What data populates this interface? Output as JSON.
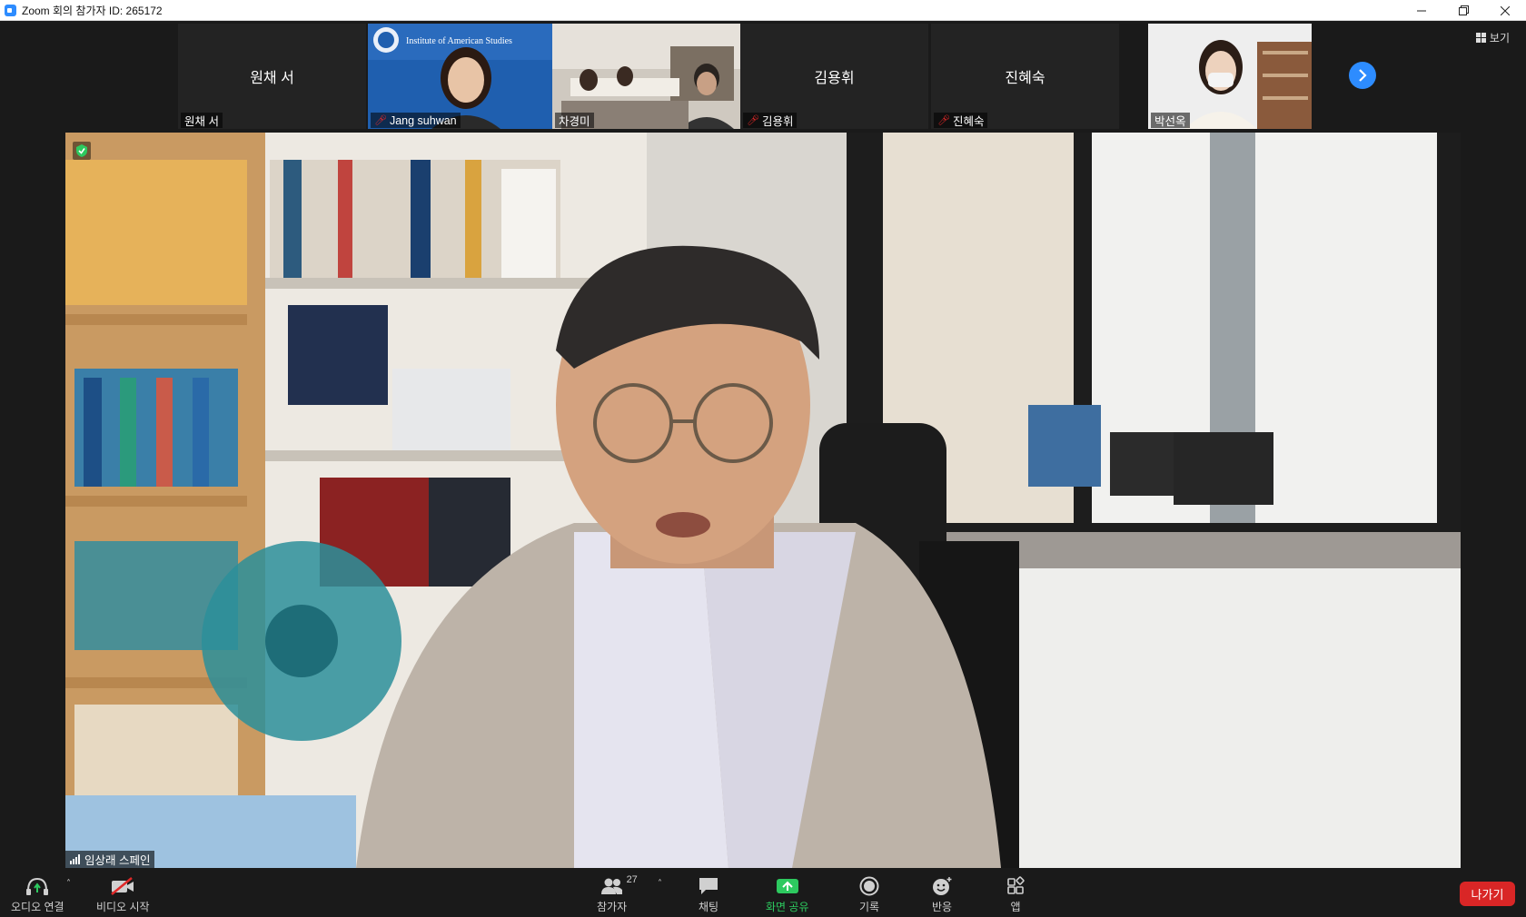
{
  "window": {
    "title": "Zoom 회의 참가자 ID: 265172"
  },
  "gallery": {
    "view_label": "보기",
    "participants": [
      {
        "display": "원채 서",
        "label": "원채 서",
        "muted": false,
        "video": false
      },
      {
        "display": "",
        "label": "Jang suhwan",
        "muted": true,
        "video": true,
        "video_text": "Institute of American Studies"
      },
      {
        "display": "",
        "label": "차경미",
        "muted": false,
        "video": true
      },
      {
        "display": "김용휘",
        "label": "김용휘",
        "muted": true,
        "video": false
      },
      {
        "display": "진혜숙",
        "label": "진혜숙",
        "muted": true,
        "video": false
      },
      {
        "display": "",
        "label": "박선옥",
        "muted": false,
        "video": true
      }
    ]
  },
  "main_video": {
    "speaker": "임상래 스페인"
  },
  "toolbar": {
    "audio_label": "오디오 연결",
    "video_label": "비디오 시작",
    "participants_label": "참가자",
    "participants_count": "27",
    "chat_label": "채팅",
    "share_label": "화면 공유",
    "record_label": "기록",
    "reactions_label": "반응",
    "apps_label": "앱",
    "leave_label": "나가기"
  },
  "colors": {
    "accent": "#2d8cff",
    "share_green": "#2dc95f",
    "leave_red": "#d92626",
    "muted_red": "#e02828"
  }
}
